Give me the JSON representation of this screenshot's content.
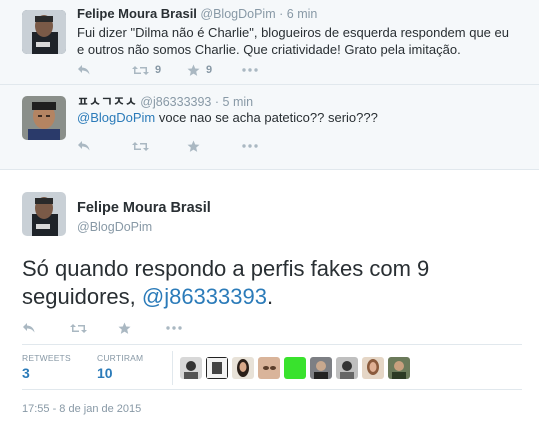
{
  "replies": [
    {
      "fullname": "Felipe Moura Brasil",
      "screenname": "@BlogDoPim",
      "time": "6 min",
      "text": "Fui dizer \"Dilma não é Charlie\", blogueiros de esquerda respondem que eu e outros não somos Charlie. Que criatividade! Grato pela imitação.",
      "retweets": "9",
      "favorites": "9"
    },
    {
      "fullname": "ㅍㅅㄱㅈㅅ",
      "screenname": "@j86333393",
      "time": "5 min",
      "mention": "@BlogDoPim",
      "text": " voce nao se acha patetico?? serio???"
    }
  ],
  "main": {
    "fullname": "Felipe Moura Brasil",
    "screenname": "@BlogDoPim",
    "text_before": "Só quando respondo a perfis fakes com 9 seguidores, ",
    "mention": "@j86333393",
    "text_after": ".",
    "retweets_label": "RETWEETS",
    "retweets_count": "3",
    "favorites_label": "CURTIRAM",
    "favorites_count": "10",
    "timestamp": "17:55 - 8 de jan de 2015"
  },
  "icons": {
    "reply": "reply-icon",
    "retweet": "retweet-icon",
    "favorite": "star-icon",
    "more": "more-icon"
  },
  "colors": {
    "link": "#2b7bb9",
    "muted": "#8899a6",
    "icon": "#aab8c2",
    "background_replies": "#f5f8fa"
  }
}
